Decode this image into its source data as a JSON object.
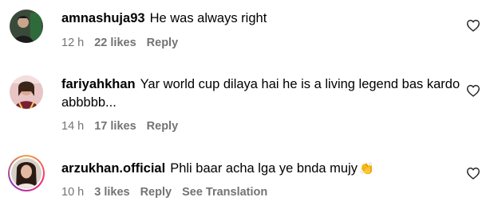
{
  "comments": [
    {
      "username": "amnashuja93",
      "text": "He was always right",
      "time": "12 h",
      "likes": "22 likes",
      "reply": "Reply",
      "avatar_icon": "profile-photo-dark",
      "like_icon": "heart-outline-icon"
    },
    {
      "username": "fariyahkhan",
      "text": "Yar world cup dilaya hai he is a living legend bas kardo abbbbb...",
      "time": "14 h",
      "likes": "17 likes",
      "reply": "Reply",
      "avatar_icon": "profile-photo-pink",
      "like_icon": "heart-outline-icon"
    },
    {
      "username": "arzukhan.official",
      "text": "Phli baar acha lga ye bnda mujy",
      "emoji": "👏",
      "time": "10 h",
      "likes": "3 likes",
      "reply": "Reply",
      "see_translation": "See Translation",
      "avatar_icon": "profile-photo-story-ring",
      "like_icon": "heart-outline-icon"
    }
  ],
  "colors": {
    "text": "#000000",
    "meta": "#737373",
    "story_ring": [
      "#f9a13a",
      "#ee2a7b",
      "#8a3ab9"
    ]
  }
}
